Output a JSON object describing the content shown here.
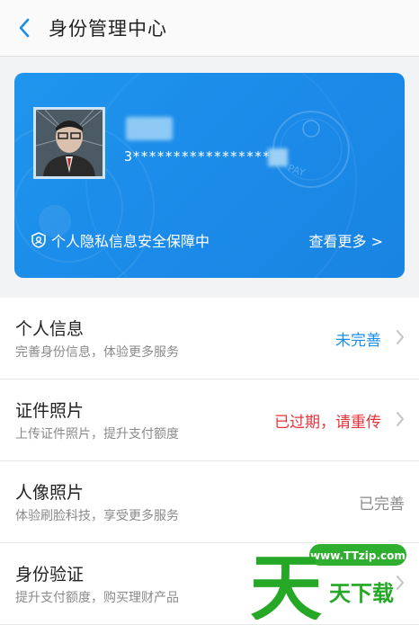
{
  "header": {
    "title": "身份管理中心"
  },
  "card": {
    "id_masked": "3*****************",
    "privacy_text": "个人隐私信息安全保障中",
    "more_link": "查看更多 >",
    "stamp_text": "PAY"
  },
  "rows": [
    {
      "title": "个人信息",
      "subtitle": "完善身份信息，体验更多服务",
      "status": "未完善",
      "status_color": "#1a8fe8"
    },
    {
      "title": "证件照片",
      "subtitle": "上传证件照片，提升支付额度",
      "status": "已过期，请重传",
      "status_color": "#e8333b"
    },
    {
      "title": "人像照片",
      "subtitle": "体验刷脸科技，享受更多服务",
      "status": "已完善",
      "status_color": "#8a8a8a"
    },
    {
      "title": "身份验证",
      "subtitle": "提升支付额度，购买理财产品",
      "status": "",
      "status_color": "#8a8a8a"
    }
  ],
  "watermark": {
    "site": "www.TTzip.com",
    "big_char": "天",
    "text": "天下载"
  }
}
